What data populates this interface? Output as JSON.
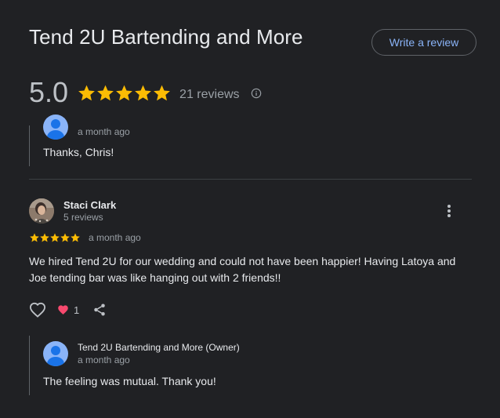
{
  "business": {
    "title": "Tend 2U Bartending and More",
    "write_review_label": "Write a review"
  },
  "summary": {
    "rating": "5.0",
    "stars": 5,
    "review_count": "21 reviews"
  },
  "top_reply": {
    "date": "a month ago",
    "text": "Thanks, Chris!"
  },
  "review": {
    "reviewer_name": "Staci Clark",
    "reviewer_review_count": "5 reviews",
    "stars": 5,
    "date": "a month ago",
    "text": "We hired Tend 2U for our wedding and could not have been happier! Having Latoya and Joe tending bar was like hanging out with 2 friends!!",
    "reaction_count": "1"
  },
  "owner_reply": {
    "name": "Tend 2U Bartending and More (Owner)",
    "date": "a month ago",
    "text": "The feeling was mutual. Thank you!"
  },
  "colors": {
    "background": "#202124",
    "star": "#fbbc04",
    "link": "#8ab4f8",
    "heart_reaction": "#f7496e"
  },
  "icons": [
    "star-icon",
    "info-icon",
    "kebab-menu-icon",
    "heart-outline-icon",
    "heart-reaction-icon",
    "share-icon",
    "owner-avatar-icon"
  ]
}
